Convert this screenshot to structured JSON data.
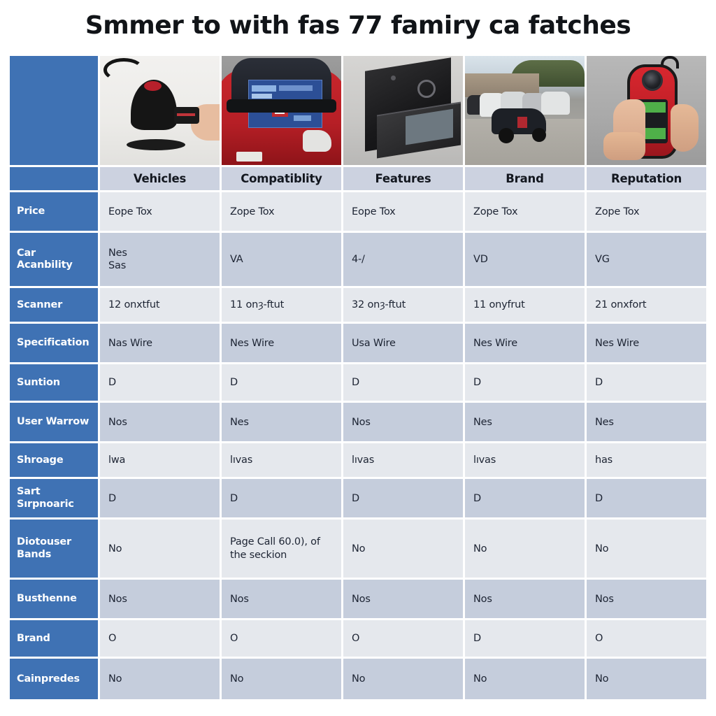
{
  "title": "Smmer to with fas 77 famiry ca fatches",
  "colors": {
    "row_label_blue": "#3f72b4",
    "header_row": "#ccd2e0",
    "row_light": "#e5e8ed",
    "row_dark": "#c5cddc",
    "page_background": "#ffffff",
    "title_text": "#111418"
  },
  "table": {
    "column_headers": [
      "Vehicles",
      "Compatiblity",
      "Features",
      "Brand",
      "Reputation"
    ],
    "images": [
      {
        "caption": "black dome car key scanner with key fob on white desk"
      },
      {
        "caption": "red car rear with blue diagnostic screen overlay"
      },
      {
        "caption": "black flat diagnostic tablet device on desk"
      },
      {
        "caption": "parking lot full of cars"
      },
      {
        "caption": "hand holding red handheld diagnostic scanner"
      }
    ],
    "rows": [
      {
        "label": "Price",
        "cells": [
          "Eope Tox",
          "Zope Tox",
          "Eope Tox",
          "Zope Tox",
          "Zope Tox"
        ]
      },
      {
        "label": "Car Acanbility",
        "cells": [
          "Nes\nSas",
          "VA",
          "4-/",
          "VD",
          "VG"
        ]
      },
      {
        "label": "Scanner",
        "cells": [
          "12 onxtfut",
          "11 onȝ-ftut",
          "32 onȝ-ftut",
          "11 onyfrut",
          "21 onxfort"
        ]
      },
      {
        "label": "Specification",
        "cells": [
          "Nas Wire",
          "Nes Wire",
          "Usa Wire",
          "Nes Wire",
          "Nes Wire"
        ]
      },
      {
        "label": "Suntion",
        "cells": [
          "D",
          "D",
          "D",
          "D",
          "D"
        ]
      },
      {
        "label": "User Warrow",
        "cells": [
          "Nos",
          "Nes",
          "Nos",
          "Nes",
          "Nes"
        ]
      },
      {
        "label": "Shroage",
        "cells": [
          "lwa",
          "lıvas",
          "lıvas",
          "lıvas",
          "has"
        ]
      },
      {
        "label": "Sart Sırpnoaric",
        "cells": [
          "D",
          "D",
          "D",
          "D",
          "D"
        ]
      },
      {
        "label": "Diotouser Bands",
        "cells": [
          "No",
          "Page Call  60.0), of the seckion",
          "No",
          "No",
          "No"
        ]
      },
      {
        "label": "Busthenne",
        "cells": [
          "Nos",
          "Nos",
          "Nos",
          "Nos",
          "Nos"
        ]
      },
      {
        "label": "Brand",
        "cells": [
          "O",
          "O",
          "O",
          "D",
          "O"
        ]
      },
      {
        "label": "Cainpredes",
        "cells": [
          "No",
          "No",
          "No",
          "No",
          "No"
        ]
      }
    ]
  }
}
